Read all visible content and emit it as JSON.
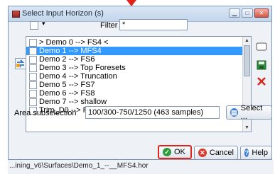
{
  "dialog": {
    "title": "Select Input Horizon (s)",
    "filter_label": "Filter",
    "filter_value": "*",
    "select_dropdown_glyph": "▾",
    "items": [
      {
        "label": "> Demo 0 --> FS4 <",
        "selected": false
      },
      {
        "label": "Demo 1 --> MFS4",
        "selected": true
      },
      {
        "label": "Demo 2 --> FS6",
        "selected": false
      },
      {
        "label": "Demo 3  --> Top Foresets",
        "selected": false
      },
      {
        "label": "Demo 4 --> Truncation",
        "selected": false
      },
      {
        "label": "Demo 5 --> FS7",
        "selected": false
      },
      {
        "label": "Demo 6 --> FS8",
        "selected": false
      },
      {
        "label": "Demo 7 --> shallow",
        "selected": false
      },
      {
        "label": "Trim_D0 --> FS4",
        "selected": false
      }
    ],
    "area_label": "Area subselection",
    "area_value": "100/300-750/1250 (463 samples)",
    "select_button": "Select ...",
    "ok_button": "OK",
    "cancel_button": "Cancel",
    "help_button": "Help"
  },
  "status": {
    "path": "...ining_v6\\Surfaces\\Demo_1_--__MFS4.hor"
  },
  "colors": {
    "selection": "#3399ff",
    "highlight_border": "#e2231a"
  },
  "icons": [
    "app-icon",
    "minimize-icon",
    "maximize-icon",
    "close-icon",
    "switch-icon",
    "rectangle-icon",
    "save-icon",
    "remove-icon",
    "select-icon",
    "ok-icon",
    "cancel-icon",
    "help-icon",
    "arrow-down-indicator"
  ]
}
